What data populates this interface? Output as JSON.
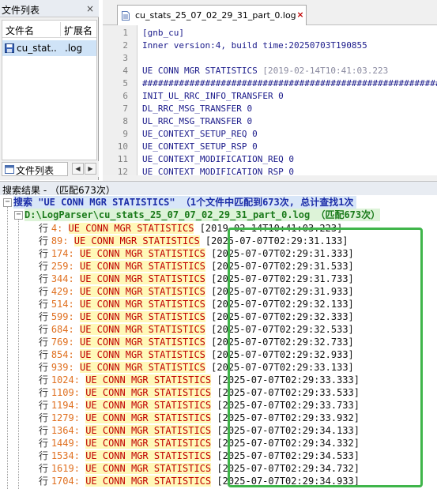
{
  "file_panel": {
    "title": "文件列表",
    "close_glyph": "×",
    "columns": [
      "文件名",
      "扩展名"
    ],
    "row": {
      "name": "cu_stat...",
      "ext": ".log"
    },
    "tab_label": "文件列表",
    "nav_prev": "◀",
    "nav_next": "▶"
  },
  "editor": {
    "tab_label": "cu_stats_25_07_02_29_31_part_0.log",
    "tab_close": "×",
    "lines": [
      {
        "n": "1",
        "text": "[gnb_cu]"
      },
      {
        "n": "2",
        "text": "Inner version:4, build time:20250703T190855"
      },
      {
        "n": "3",
        "text": ""
      },
      {
        "n": "4",
        "text": "UE CONN MGR STATISTICS ",
        "grey": "[2019-02-14T10:41:03.223"
      },
      {
        "n": "5",
        "text": "################################################################"
      },
      {
        "n": "6",
        "text": "INIT_UL_RRC_INFO_TRANSFER    0"
      },
      {
        "n": "7",
        "text": "DL_RRC_MSG_TRANSFER          0"
      },
      {
        "n": "8",
        "text": "UL_RRC_MSG_TRANSFER          0"
      },
      {
        "n": "9",
        "text": "UE_CONTEXT_SETUP_REQ         0"
      },
      {
        "n": "10",
        "text": "UE_CONTEXT_SETUP_RSP         0"
      },
      {
        "n": "11",
        "text": "UE_CONTEXT_MODIFICATION_REQ  0"
      },
      {
        "n": "12",
        "text": "UE_CONTEXT_MODIFICATION_RSP  0"
      }
    ]
  },
  "results": {
    "header": "搜索结果 - （匹配673次）",
    "search_summary": "搜索 \"UE CONN MGR STATISTICS\" （1个文件中匹配到673次, 总计查找1次",
    "file_summary": "D:\\LogParser\\cu_stats_25_07_07_02_29_31_part_0.log （匹配673次）",
    "line_prefix": "行",
    "keyword": "UE CONN MGR STATISTICS",
    "rows": [
      {
        "line": "4",
        "ts": "[2019-02-14T10:41:03.223]"
      },
      {
        "line": "89",
        "ts": "[2025-07-07T02:29:31.133]"
      },
      {
        "line": "174",
        "ts": "[2025-07-07T02:29:31.333]"
      },
      {
        "line": "259",
        "ts": "[2025-07-07T02:29:31.533]"
      },
      {
        "line": "344",
        "ts": "[2025-07-07T02:29:31.733]"
      },
      {
        "line": "429",
        "ts": "[2025-07-07T02:29:31.933]"
      },
      {
        "line": "514",
        "ts": "[2025-07-07T02:29:32.133]"
      },
      {
        "line": "599",
        "ts": "[2025-07-07T02:29:32.333]"
      },
      {
        "line": "684",
        "ts": "[2025-07-07T02:29:32.533]"
      },
      {
        "line": "769",
        "ts": "[2025-07-07T02:29:32.733]"
      },
      {
        "line": "854",
        "ts": "[2025-07-07T02:29:32.933]"
      },
      {
        "line": "939",
        "ts": "[2025-07-07T02:29:33.133]"
      },
      {
        "line": "1024",
        "ts": "[2025-07-07T02:29:33.333]"
      },
      {
        "line": "1109",
        "ts": "[2025-07-07T02:29:33.533]"
      },
      {
        "line": "1194",
        "ts": "[2025-07-07T02:29:33.733]"
      },
      {
        "line": "1279",
        "ts": "[2025-07-07T02:29:33.932]"
      },
      {
        "line": "1364",
        "ts": "[2025-07-07T02:29:34.133]"
      },
      {
        "line": "1449",
        "ts": "[2025-07-07T02:29:34.332]"
      },
      {
        "line": "1534",
        "ts": "[2025-07-07T02:29:34.533]"
      },
      {
        "line": "1619",
        "ts": "[2025-07-07T02:29:34.732]"
      },
      {
        "line": "1704",
        "ts": "[2025-07-07T02:29:34.933]"
      }
    ]
  },
  "colors": {
    "highlight_box": "#3fb54a",
    "keyword": "#c00000",
    "line_number": "#e07020",
    "search_line": "#1c2ea8",
    "file_line": "#1a7a1a"
  }
}
